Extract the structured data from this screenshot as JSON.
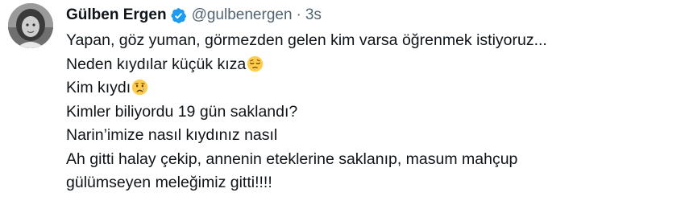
{
  "author": {
    "name": "Gülben Ergen",
    "handle": "@gulbenergen",
    "separator": "·",
    "time": "3s",
    "verified": true
  },
  "tweet": {
    "lines": [
      "Yapan, göz yuman, görmezden gelen kim varsa öğrenmek istiyoruz...",
      "Neden kıydılar küçük kıza",
      "Kim kıydı",
      "Kimler biliyordu 19 gün saklandı?",
      "Narin’imize nasıl kıydınız nasıl",
      "Ah gitti halay çekip, annenin eteklerine saklanıp, masum mahçup",
      "gülümseyen meleğimiz gitti!!!!"
    ],
    "emojis": {
      "line2": "pensive-face",
      "line3": "crying-face"
    }
  },
  "colors": {
    "text": "#0f1419",
    "secondary": "#536471",
    "verified": "#1d9bf0",
    "emoji": "#ffcc4d"
  }
}
